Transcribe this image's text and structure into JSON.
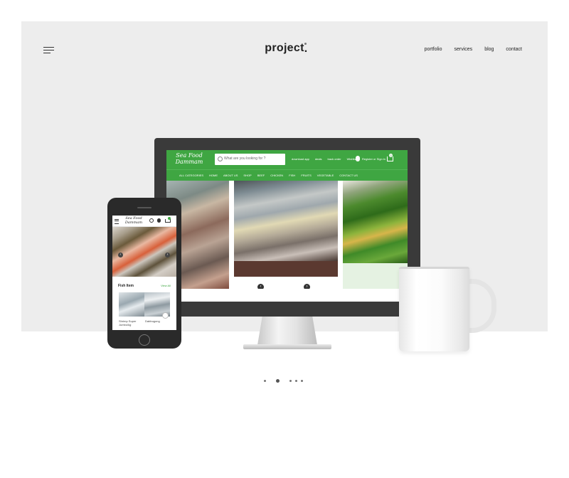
{
  "header": {
    "logo": "project",
    "logo_dot": ".",
    "nav": [
      "portfolio",
      "services",
      "blog",
      "contact"
    ]
  },
  "desktop_site": {
    "brand_line1": "Sea Food",
    "brand_line2": "Dammam",
    "search_placeholder": "What are you looking for ?",
    "header_links": [
      "download app",
      "deals",
      "track order",
      "Wishlist"
    ],
    "account_link": "Register or Sign in",
    "cart_count": "0",
    "categories": [
      "ALL CATEGORIES",
      "HOME",
      "ABOUT US",
      "SHOP",
      "BEEF",
      "CHICKEN",
      "FISH",
      "FRUITS",
      "VEGETABLE",
      "CONTACT US"
    ],
    "accent_color": "#3fa642"
  },
  "mobile_site": {
    "brand_line1": "Sea Food",
    "brand_line2": "Dammam",
    "section_title": "Fish Item",
    "view_all": "View All",
    "products": [
      "Shrimp Super Jumbo/kg",
      "Dabbugong"
    ]
  },
  "slider": {
    "dot_count": 5,
    "active_index": 1
  }
}
